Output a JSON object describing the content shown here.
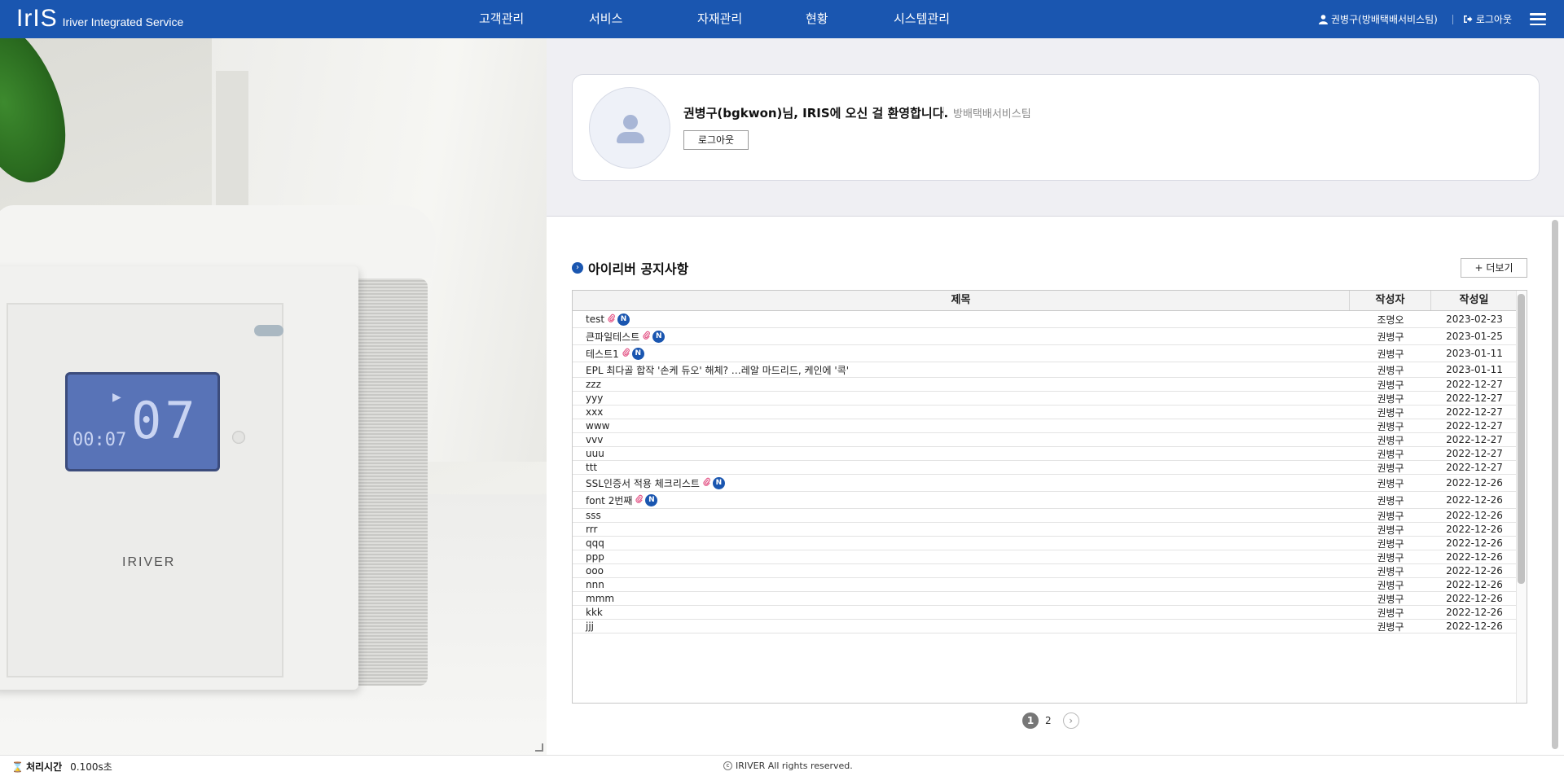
{
  "header": {
    "logo": "IrIS",
    "subtitle": "Iriver Integrated Service",
    "nav": [
      {
        "label": "고객관리"
      },
      {
        "label": "서비스"
      },
      {
        "label": "자재관리"
      },
      {
        "label": "현황"
      },
      {
        "label": "시스템관리"
      }
    ],
    "user_label": "권병구(방배택배서비스팀)",
    "logout_label": "로그아웃",
    "icons": {
      "user": "user-icon",
      "logout": "logout-icon",
      "menu": "hamburger-menu-icon"
    },
    "color": "#1a56b0"
  },
  "hero": {
    "device_brand": "IRIVER",
    "lcd_big": "07",
    "lcd_small": "00:07"
  },
  "profile": {
    "welcome": "권병구(bgkwon)님, IRIS에 오신 걸 환영합니다.",
    "team": "방배택배서비스팀",
    "logout_button": "로그아웃"
  },
  "notice": {
    "title": "아이리버 공지사항",
    "more_button": "+ 더보기",
    "columns": [
      "제목",
      "작성자",
      "작성일"
    ],
    "rows": [
      {
        "title": "test",
        "author": "조명오",
        "date": "2023-02-23",
        "attach": true,
        "new": true
      },
      {
        "title": "큰파일테스트",
        "author": "권병구",
        "date": "2023-01-25",
        "attach": true,
        "new": true
      },
      {
        "title": "테스트1",
        "author": "권병구",
        "date": "2023-01-11",
        "attach": true,
        "new": true
      },
      {
        "title": "EPL 최다골 합작 '손케 듀오' 해체? …레알 마드리드, 케인에 '콕'",
        "author": "권병구",
        "date": "2023-01-11",
        "attach": false,
        "new": false
      },
      {
        "title": "zzz",
        "author": "권병구",
        "date": "2022-12-27",
        "attach": false,
        "new": false
      },
      {
        "title": "yyy",
        "author": "권병구",
        "date": "2022-12-27",
        "attach": false,
        "new": false
      },
      {
        "title": "xxx",
        "author": "권병구",
        "date": "2022-12-27",
        "attach": false,
        "new": false
      },
      {
        "title": "www",
        "author": "권병구",
        "date": "2022-12-27",
        "attach": false,
        "new": false
      },
      {
        "title": "vvv",
        "author": "권병구",
        "date": "2022-12-27",
        "attach": false,
        "new": false
      },
      {
        "title": "uuu",
        "author": "권병구",
        "date": "2022-12-27",
        "attach": false,
        "new": false
      },
      {
        "title": "ttt",
        "author": "권병구",
        "date": "2022-12-27",
        "attach": false,
        "new": false
      },
      {
        "title": "SSL인증서 적용 체크리스트",
        "author": "권병구",
        "date": "2022-12-26",
        "attach": true,
        "new": true
      },
      {
        "title": "font 2번째",
        "author": "권병구",
        "date": "2022-12-26",
        "attach": true,
        "new": true
      },
      {
        "title": "sss",
        "author": "권병구",
        "date": "2022-12-26",
        "attach": false,
        "new": false
      },
      {
        "title": "rrr",
        "author": "권병구",
        "date": "2022-12-26",
        "attach": false,
        "new": false
      },
      {
        "title": "qqq",
        "author": "권병구",
        "date": "2022-12-26",
        "attach": false,
        "new": false
      },
      {
        "title": "ppp",
        "author": "권병구",
        "date": "2022-12-26",
        "attach": false,
        "new": false
      },
      {
        "title": "ooo",
        "author": "권병구",
        "date": "2022-12-26",
        "attach": false,
        "new": false
      },
      {
        "title": "nnn",
        "author": "권병구",
        "date": "2022-12-26",
        "attach": false,
        "new": false
      },
      {
        "title": "mmm",
        "author": "권병구",
        "date": "2022-12-26",
        "attach": false,
        "new": false
      },
      {
        "title": "kkk",
        "author": "권병구",
        "date": "2022-12-26",
        "attach": false,
        "new": false
      },
      {
        "title": "jjj",
        "author": "권병구",
        "date": "2022-12-26",
        "attach": false,
        "new": false
      }
    ],
    "pagination": {
      "current": "1",
      "pages": [
        "2"
      ],
      "next_icon": "chevron-right-icon"
    },
    "attach_icon": "paperclip-icon",
    "new_badge": "N"
  },
  "footer": {
    "processing_label": "처리시간",
    "processing_value": "0.100s초",
    "copyright": "IRIVER All rights reserved.",
    "hourglass_icon": "hourglass-icon"
  }
}
